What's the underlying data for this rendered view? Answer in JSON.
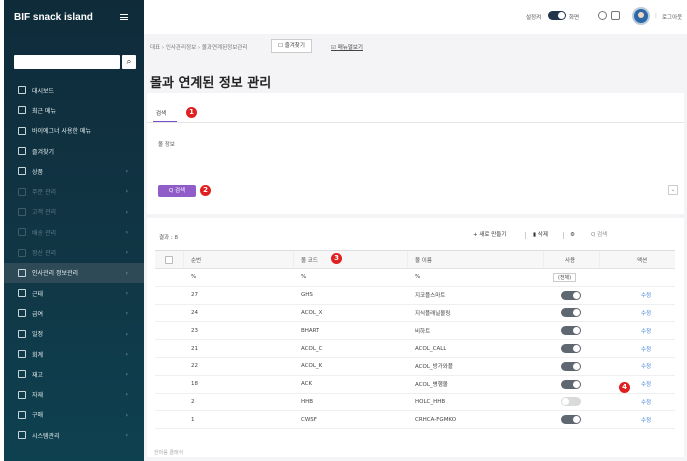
{
  "app": {
    "logo_text": "BIF snack island"
  },
  "sidebar": {
    "items": [
      {
        "label": "대시보드",
        "chev": "",
        "dim": false
      },
      {
        "label": "최근 메뉴",
        "chev": "",
        "dim": false
      },
      {
        "label": "바이에그너 사용한 메뉴",
        "chev": "",
        "dim": false
      },
      {
        "label": "즐겨찾기",
        "chev": "",
        "dim": false
      },
      {
        "label": "상품",
        "chev": "›",
        "dim": false
      },
      {
        "label": "주문 관리",
        "chev": "›",
        "dim": true
      },
      {
        "label": "고객 관리",
        "chev": "›",
        "dim": true
      },
      {
        "label": "배송 관리",
        "chev": "›",
        "dim": true
      },
      {
        "label": "정산 관리",
        "chev": "›",
        "dim": true
      },
      {
        "label": "인사관리 정보관리",
        "chev": "›",
        "dim": false,
        "active": true
      },
      {
        "label": "근태",
        "chev": "›",
        "dim": false
      },
      {
        "label": "급여",
        "chev": "›",
        "dim": false
      },
      {
        "label": "일정",
        "chev": "›",
        "dim": false
      },
      {
        "label": "회계",
        "chev": "›",
        "dim": false
      },
      {
        "label": "재고",
        "chev": "›",
        "dim": false
      },
      {
        "label": "자재",
        "chev": "›",
        "dim": false
      },
      {
        "label": "구매",
        "chev": "›",
        "dim": false
      },
      {
        "label": "시스템관리",
        "chev": "›",
        "dim": false
      }
    ]
  },
  "topbar": {
    "mode_label": "설정켜",
    "mode_label2": "화면",
    "logout_label": "로그아웃"
  },
  "header": {
    "breadcrumb": "대표 › 인사관리정보 › 몰과연계된정보관리",
    "favorite_button": "즐겨찾기",
    "manual_link": "매뉴얼보기",
    "title": "몰과 연계된 정보 관리"
  },
  "tabs": [
    {
      "label": "검색"
    }
  ],
  "search_section": {
    "label": "몰 정보",
    "search_button": "Q 검색",
    "collapse_icon": "chevron-down-icon"
  },
  "toolbar": {
    "result_count": "결과 : 8",
    "excel_button": "+ 새로 만들기",
    "delete_button": "삭제",
    "settings_icon": "gear-icon",
    "search_placeholder": "Q 검색"
  },
  "table": {
    "columns": [
      "",
      "순번",
      "몰 코드",
      "몰 이름",
      "사용",
      "액션"
    ],
    "filter_row": {
      "num": "%",
      "code": "%",
      "name": "%",
      "use": "(전체)"
    },
    "rows": [
      {
        "num": "27",
        "code": "GHS",
        "name": "지코플스마트",
        "use": true,
        "action": "수정"
      },
      {
        "num": "24",
        "code": "ACOL_X",
        "name": "지식플래닐몰링",
        "use": true,
        "action": "수정"
      },
      {
        "num": "23",
        "code": "BHART",
        "name": "비하트",
        "use": true,
        "action": "수정"
      },
      {
        "num": "21",
        "code": "ACOL_C",
        "name": "ACOL_CALL",
        "use": true,
        "action": "수정"
      },
      {
        "num": "22",
        "code": "ACOL_K",
        "name": "ACOL_방가와플",
        "use": true,
        "action": "수정"
      },
      {
        "num": "18",
        "code": "ACK",
        "name": "ACOL_병행몰",
        "use": true,
        "action": "수정"
      },
      {
        "num": "2",
        "code": "HHB",
        "name": "HOLC_HHB",
        "use": false,
        "action": "수정"
      },
      {
        "num": "1",
        "code": "CWSF",
        "name": "CRHCA-FGMKO",
        "use": true,
        "action": "수정"
      }
    ]
  },
  "footer": {
    "text": "한마음 클래식"
  },
  "badges": [
    "1",
    "2",
    "3",
    "4"
  ]
}
